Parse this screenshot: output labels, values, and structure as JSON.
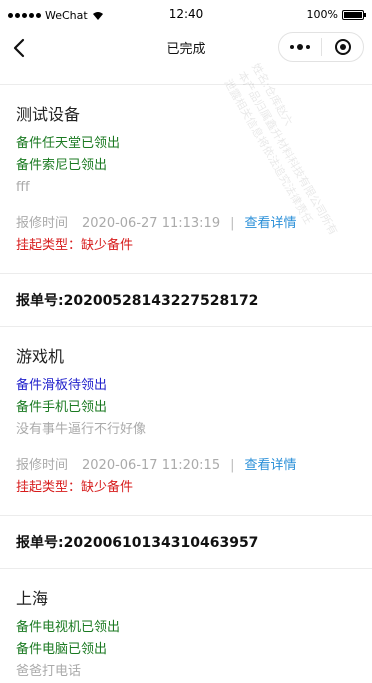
{
  "status_bar": {
    "carrier": "WeChat",
    "time": "12:40",
    "battery": "100%",
    "battery_level": 1.0
  },
  "nav": {
    "title": "已完成"
  },
  "orders": [
    {
      "device": "测试设备",
      "parts": [
        {
          "text": "备件任天堂已领出",
          "color": "green"
        },
        {
          "text": "备件索尼已领出",
          "color": "green"
        }
      ],
      "note": "fff",
      "repair_label": "报修时间",
      "repair_time": "2020-06-27 11:13:19",
      "detail_link": "查看详情",
      "suspend": "挂起类型：缺少备件"
    },
    {
      "order_no": "报单号:20200528143227528172",
      "device": "游戏机",
      "parts": [
        {
          "text": "备件滑板待领出",
          "color": "blue"
        },
        {
          "text": "备件手机已领出",
          "color": "green"
        }
      ],
      "note": "没有事牛逼行不行好像",
      "repair_label": "报修时间",
      "repair_time": "2020-06-17 11:20:15",
      "detail_link": "查看详情",
      "suspend": "挂起类型：缺少备件"
    },
    {
      "order_no": "报单号:20200610134310463957",
      "device": "上海",
      "parts": [
        {
          "text": "备件电视机已领出",
          "color": "green"
        },
        {
          "text": "备件电脑已领出",
          "color": "green"
        }
      ],
      "note": "爸爸打电话"
    }
  ],
  "watermark": {
    "lines": [
      "姓名:仓库赵六",
      "本产品归属鑫升材料科技有限公司所有",
      "泄露相关信息将依法追究法律责任"
    ]
  }
}
